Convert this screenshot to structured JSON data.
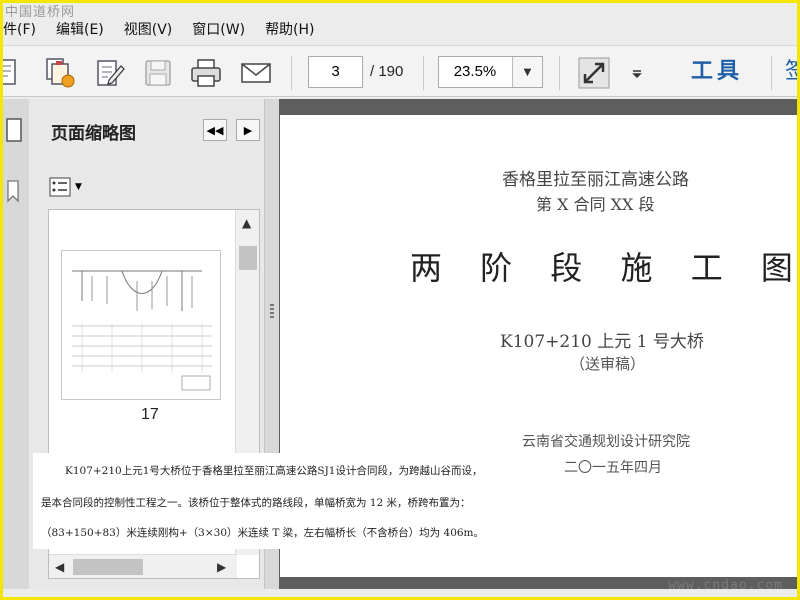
{
  "watermark": {
    "site_name": "中国道桥网",
    "url": "www.cndao.com"
  },
  "menu": [
    "件(F)",
    "编辑(E)",
    "视图(V)",
    "窗口(W)",
    "帮助(H)"
  ],
  "toolbar": {
    "icons": [
      "create-pdf-icon",
      "combine-files-icon",
      "edit-icon",
      "save-icon",
      "print-icon",
      "email-icon",
      "fit-window-icon",
      "more-menu-icon"
    ],
    "current_page": "3",
    "total_pages": "/ 190",
    "zoom": "23.5%",
    "tools_label": "工具",
    "sign_label": "签"
  },
  "panel": {
    "title": "页面缩略图",
    "thumbnail_page_label": "17"
  },
  "document": {
    "line1": "香格里拉至丽江高速公路",
    "line2": "第 X 合同 XX 段",
    "title": "两 阶 段 施 工 图 设 计",
    "bridge": "K107+210 上元 1 号大桥",
    "draft": "（送审稿）",
    "institute": "云南省交通规划设计研究院",
    "date": "二〇一五年四月"
  },
  "caption": {
    "lines": [
      "K107+210上元1号大桥位于香格里拉至丽江高速公路SJ1设计合同段，为跨越山谷而设，",
      "是本合同段的控制性工程之一。该桥位于整体式的路线段，单幅桥宽为 12 米，桥跨布置为：",
      "（83+150+83）米连续刚构+（3×30）米连续 T 梁，左右幅桥长（不含桥台）均为 406m。"
    ]
  },
  "colors": {
    "frame_border": "#f5e600",
    "accent_blue": "#1f5fa8",
    "document_background": "#5e5e5e"
  }
}
